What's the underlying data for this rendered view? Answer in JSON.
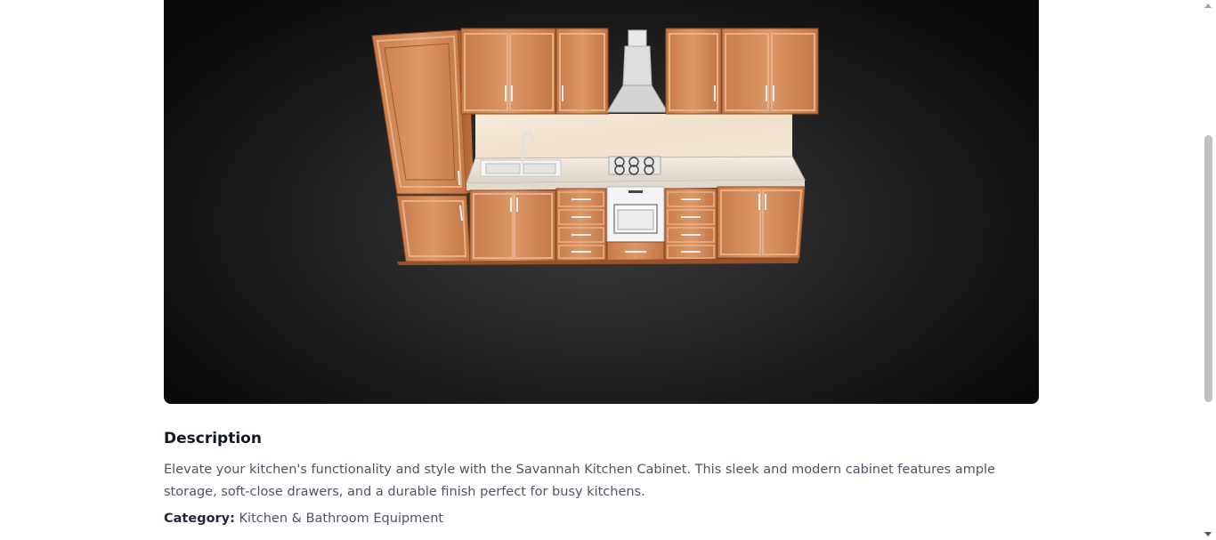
{
  "viewer": {
    "model_name": "Savannah Kitchen Cabinet",
    "background_color": "#1c1c1c"
  },
  "description": {
    "heading": "Description",
    "text": "Elevate your kitchen's functionality and style with the Savannah Kitchen Cabinet. This sleek and modern cabinet features ample storage, soft-close drawers, and a durable finish perfect for busy kitchens.",
    "category_label": "Category:",
    "category_value": "Kitchen & Bathroom Equipment"
  },
  "scrollbar": {
    "up_icon": "arrow-up-icon",
    "down_icon": "arrow-down-icon"
  }
}
